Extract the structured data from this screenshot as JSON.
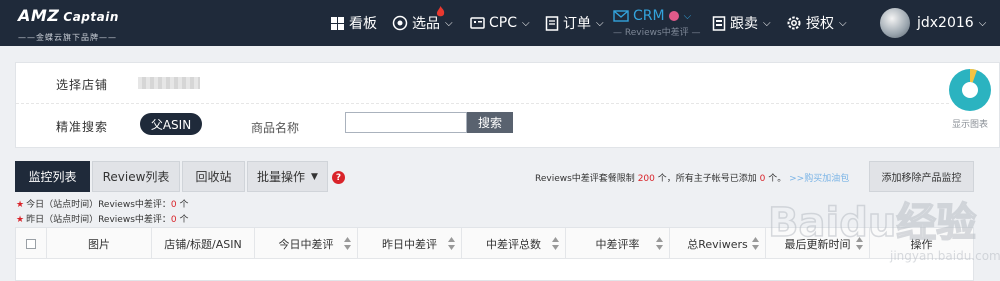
{
  "brand": {
    "name": "AMZ",
    "name2": "Captain",
    "tagline": "——金蝶云旗下品牌——"
  },
  "nav": {
    "dashboard": "看板",
    "product_select": "选品",
    "cpc": "CPC",
    "orders": "订单",
    "crm": "CRM",
    "crm_sub": "— Reviews中差评 —",
    "follow": "跟卖",
    "auth": "授权",
    "username": "jdx2016"
  },
  "filters": {
    "store_label": "选择店铺",
    "search_label": "精准搜索",
    "asin_pill": "父ASIN",
    "product_name_label": "商品名称",
    "search_input_value": "",
    "search_button": "搜索",
    "chart_label": "显示图表"
  },
  "tabs": {
    "monitor": "监控列表",
    "review": "Review列表",
    "recycle": "回收站",
    "batch": "批量操作"
  },
  "quota": {
    "prefix": "Reviews中差评套餐限制",
    "limit": "200",
    "mid": "个，所有主子帐号已添加",
    "added": "0",
    "suffix": "个。",
    "link": ">>购买加油包"
  },
  "add_button": "添加移除产品监控",
  "stats": {
    "today_label": "今日（站点时间）Reviews中差评：",
    "today_value": "0",
    "yesterday_label": "昨日（站点时间）Reviews中差评：",
    "yesterday_value": "0",
    "unit": "个"
  },
  "table": {
    "columns": [
      "图片",
      "店铺/标题/ASIN",
      "今日中差评",
      "昨日中差评",
      "中差评总数",
      "中差评率",
      "总Reviwers",
      "最后更新时间",
      "操作"
    ]
  },
  "watermark": {
    "text": "Baidu经验",
    "sub": "jingyan.baidu.com"
  },
  "colors": {
    "nav_bg": "#1f2a3a",
    "accent": "#33a3dc",
    "danger": "#d9242a",
    "chart_teal": "#2bb3c0",
    "chart_yellow": "#f5c342"
  }
}
